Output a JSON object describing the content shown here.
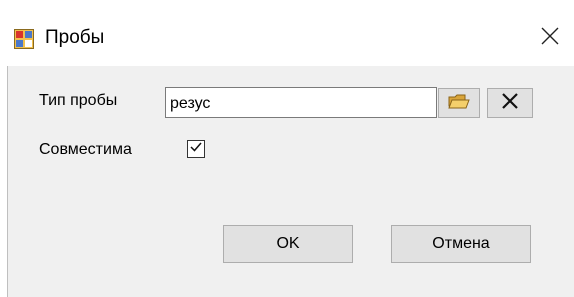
{
  "window": {
    "title": "Пробы",
    "icon": "app-window-icon",
    "close_icon": "close-icon"
  },
  "form": {
    "type_label": "Тип пробы",
    "type_value": "резус",
    "browse_icon": "folder-browse-icon",
    "clear_icon": "clear-x-icon",
    "compatible_label": "Совместима",
    "compatible_checked": true
  },
  "buttons": {
    "ok_label": "OK",
    "cancel_label": "Отмена"
  }
}
